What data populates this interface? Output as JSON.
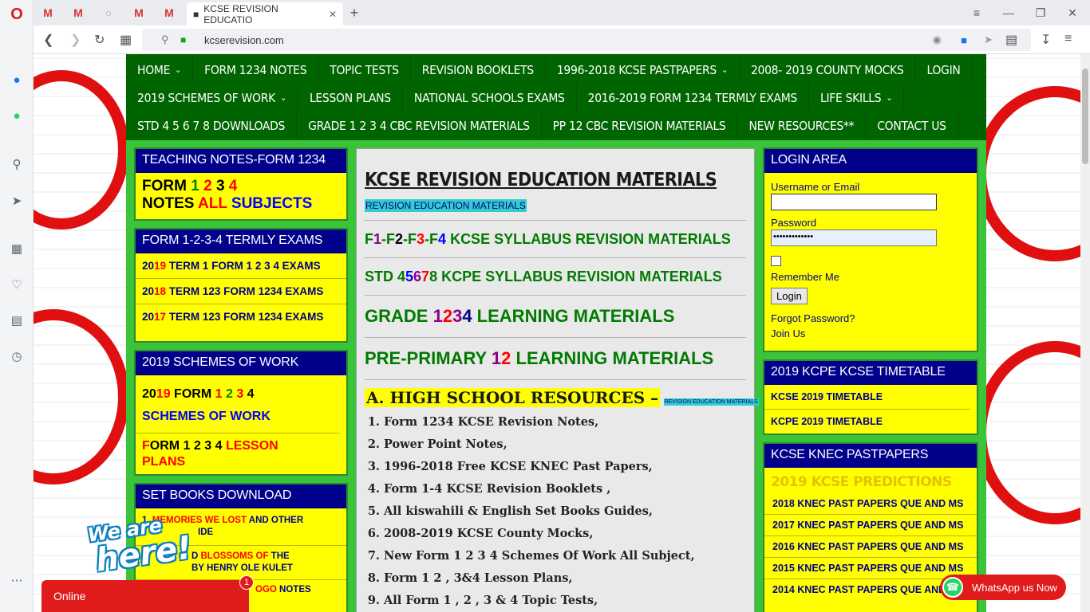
{
  "browser": {
    "active_tab_title": "KCSE REVISION EDUCATIO",
    "url": "kcserevision.com"
  },
  "nav": {
    "row1": [
      "HOME",
      "FORM 1234 NOTES",
      "TOPIC TESTS",
      "REVISION BOOKLETS",
      "1996-2018 KCSE PASTPAPERS",
      "2008- 2019 COUNTY MOCKS",
      "LOGIN"
    ],
    "row2": [
      "2019 SCHEMES OF WORK",
      "LESSON PLANS",
      "NATIONAL SCHOOLS EXAMS",
      "2016-2019 FORM 1234 TERMLY EXAMS",
      "LIFE SKILLS"
    ],
    "row3": [
      "STD 4 5 6 7 8 DOWNLOADS",
      "GRADE 1 2 3 4 CBC REVISION MATERIALS",
      "PP 12 CBC REVISION MATERIALS",
      "NEW RESOURCES**",
      "CONTACT US"
    ]
  },
  "left": {
    "teaching_notes": {
      "header": "TEACHING NOTES-FORM 1234",
      "word_form": "FORM",
      "word_notes": "NOTES",
      "word_all": "ALL",
      "word_subjects": "SUBJECTS"
    },
    "termly": {
      "header": "FORM 1-2-3-4 TERMLY EXAMS",
      "items": [
        {
          "yr_a": "20",
          "yr_b": "19",
          "rest": " TERM 1 FORM 1 2 3 4 EXAMS"
        },
        {
          "yr_a": "20",
          "yr_b": "18",
          "rest": " TERM 123 FORM 1234 EXAMS"
        },
        {
          "yr_a": "20",
          "yr_b": "17",
          "rest": " TERM 123 FORM 1234 EXAMS"
        }
      ]
    },
    "schemes": {
      "header": "2019 SCHEMES OF WORK",
      "yr_a": "20",
      "yr_b": "19",
      "form": " FORM ",
      "schemes_text": "SCHEMES OF WORK",
      "f": "F",
      "orm_nums": "ORM 1 2 3 4 ",
      "lesson": "LESSON",
      "plans": "PLANS"
    },
    "setbooks": {
      "header": "SET BOOKS DOWNLOAD",
      "i1_num": "1. ",
      "i1_red": "MEMORIES WE LOST",
      "i1_rest": " AND OTHER",
      "i1_line2": "IDE",
      "i2_a": "D ",
      "i2_red": "BLOSSOMS OF",
      "i2_rest": " THE",
      "i2_line2": "BY HENRY OLE KULET",
      "i3_red": "OGO",
      "i3_rest": " NOTES"
    }
  },
  "center": {
    "title": "KCSE REVISION EDUCATION MATERIALS",
    "subtitle": "REVISION EDUCATION MATERIALS",
    "h_kcse_rest": " KCSE SYLLABUS REVISION MATERIALS",
    "h_std_prefix": "STD 4",
    "h_std_rest": "  KCPE SYLLABUS REVISION MATERIALS",
    "h_grade_prefix": "GRADE ",
    "h_grade_rest": " LEARNING MATERIALS",
    "h_pp_prefix": "PRE-PRIMARY ",
    "h_pp_rest": " LEARNING MATERIALS",
    "section_a": "A. HIGH SCHOOL RESOURCES –",
    "section_a_tag": "REVISION EDUCATION MATERIALS",
    "resources": [
      "Form 1234 KCSE Revision Notes,",
      "Power Point Notes,",
      "1996-2018 Free KCSE KNEC Past Papers,",
      "Form 1-4 KCSE Revision Booklets ,",
      "All kiswahili & English Set Books Guides,",
      "2008-2019 KCSE County Mocks,",
      "New Form 1 2 3 4 Schemes Of Work All Subject,",
      "Form 1 2 , 3&4 Lesson Plans,",
      "All Form 1 , 2 , 3 & 4 Topic Tests,"
    ]
  },
  "right": {
    "login": {
      "header": "LOGIN AREA",
      "username_label": "Username or Email",
      "password_label": "Password",
      "password_value": "•••••••••••••",
      "remember": "Remember Me",
      "login_btn": "Login",
      "forgot": "Forgot Password?",
      "join": "Join Us"
    },
    "timetable": {
      "header": "2019 KCPE KCSE TIMETABLE",
      "items": [
        "KCSE 2019 TIMETABLE",
        "KCPE 2019 TIMETABLE"
      ]
    },
    "pastpapers": {
      "header": "KCSE KNEC PASTPAPERS",
      "predictions": "2019 KCSE PREDICTIONS",
      "items": [
        "2018 KNEC PAST PAPERS QUE AND MS",
        "2017 KNEC PAST PAPERS QUE AND MS",
        "2016 KNEC PAST PAPERS QUE AND MS",
        "2015 KNEC PAST PAPERS QUE AND MS",
        "2014 KNEC PAST PAPERS QUE AND MS"
      ]
    }
  },
  "widgets": {
    "we_are": "We are",
    "here": "here!",
    "online": "Online",
    "badge": "1",
    "whatsapp": "WhatsApp us Now"
  },
  "colors": {
    "menu_bg": "#006400",
    "accent_green": "#39c43a",
    "box_yellow": "#ffff00",
    "header_blue": "#00008b",
    "chat_red": "#e01b1b"
  }
}
